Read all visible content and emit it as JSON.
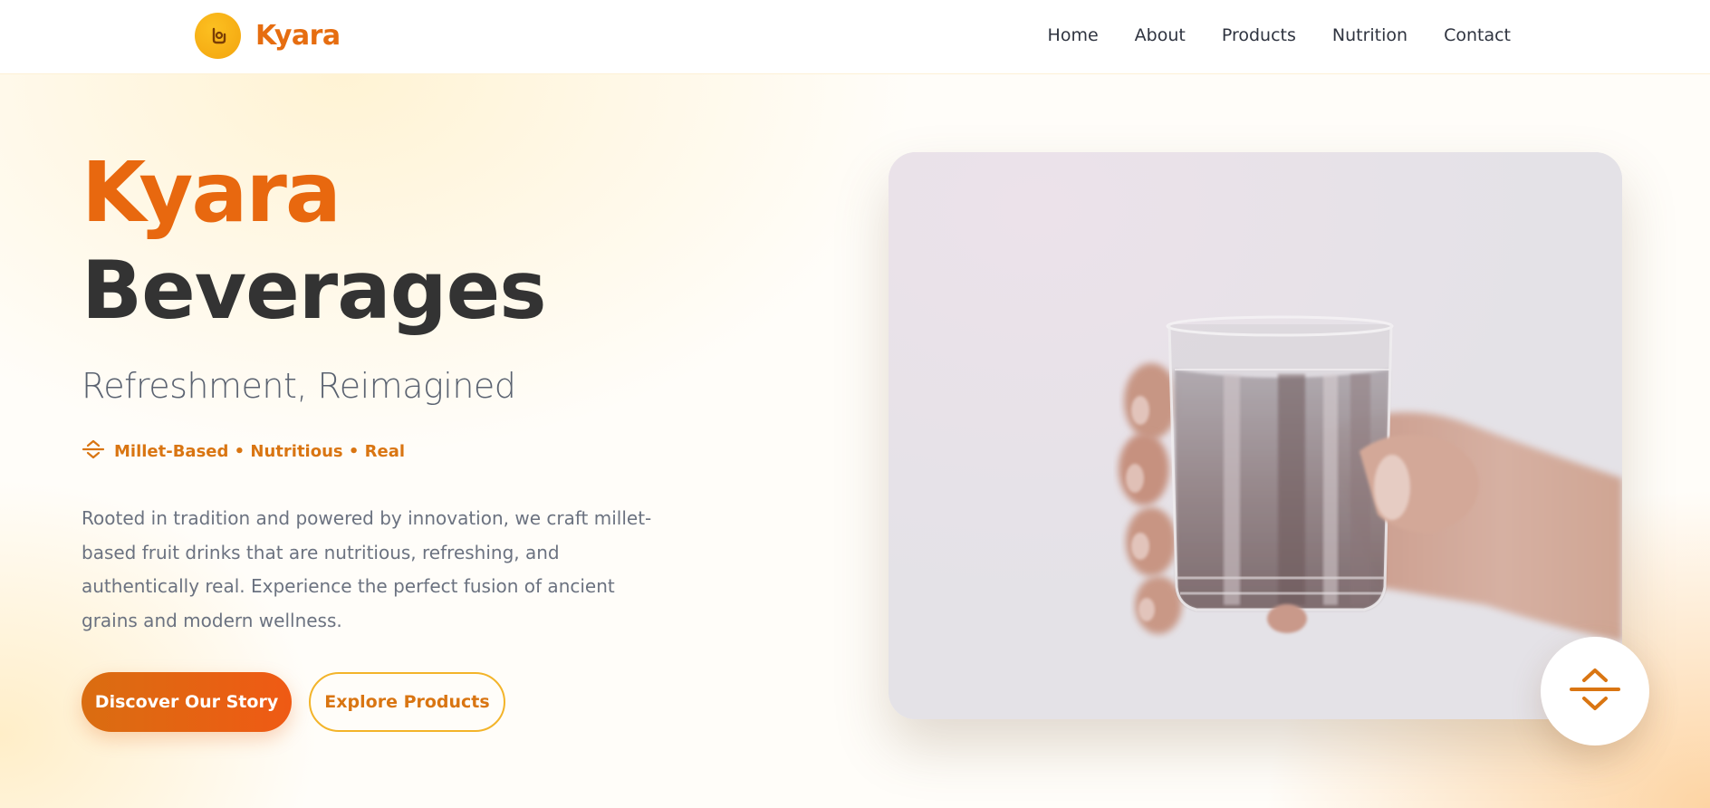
{
  "header": {
    "brand": "Kyara",
    "nav": [
      {
        "label": "Home"
      },
      {
        "label": "About"
      },
      {
        "label": "Products"
      },
      {
        "label": "Nutrition"
      },
      {
        "label": "Contact"
      }
    ]
  },
  "hero": {
    "title_line1": "Kyara",
    "title_line2": "Beverages",
    "subtitle": "Refreshment, Reimagined",
    "tagline": "Millet-Based • Nutritious • Real",
    "description": "Rooted in tradition and powered by innovation, we craft millet-based fruit drinks that are nutritious, refreshing, and authentically real. Experience the perfect fusion of ancient grains and modern wellness.",
    "primary_cta": "Discover Our Story",
    "secondary_cta": "Explore Products"
  },
  "icons": {
    "logo": "drink-logo-icon",
    "tagline": "grain-icon",
    "scroll": "expand-icon"
  },
  "colors": {
    "brand_orange": "#e8680f",
    "accent_amber": "#f3b42a",
    "heading_dark": "#333333",
    "body_gray": "#6b7280"
  }
}
